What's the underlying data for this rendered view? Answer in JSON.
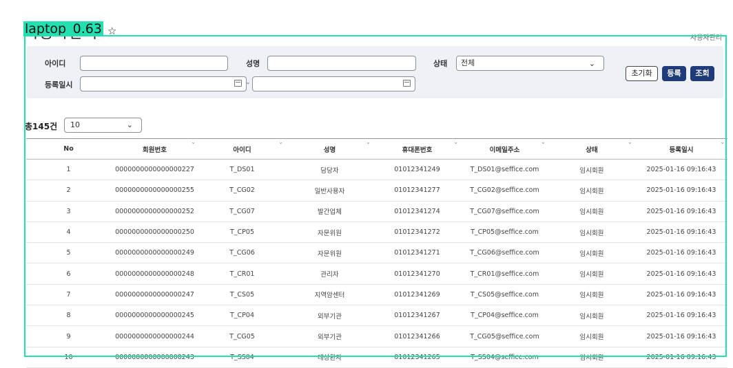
{
  "overlay": {
    "label": "laptop_0.63"
  },
  "header": {
    "title": "사용자관리",
    "breadcrumb": "사용자관리"
  },
  "search": {
    "id_label": "아이디",
    "name_label": "성명",
    "status_label": "상태",
    "status_value": "전체",
    "date_label": "등록일시",
    "date_separator": "-",
    "reset_label": "초기화",
    "register_label": "등록",
    "search_label": "조회"
  },
  "list": {
    "total_text": "총145건",
    "page_size": "10"
  },
  "table": {
    "headers": [
      "No",
      "회원번호",
      "아이디",
      "성명",
      "휴대폰번호",
      "이메일주소",
      "상태",
      "등록일시"
    ],
    "rows": [
      [
        "1",
        "0000000000000000227",
        "T_DS01",
        "담당자",
        "01012341249",
        "T_DS01@seffice.com",
        "임시회원",
        "2025-01-16 09:16:43"
      ],
      [
        "2",
        "0000000000000000255",
        "T_CG02",
        "일반사용자",
        "01012341277",
        "T_CG02@seffice.com",
        "임시회원",
        "2025-01-16 09:16:43"
      ],
      [
        "3",
        "0000000000000000252",
        "T_CG07",
        "발간업체",
        "01012341274",
        "T_CG07@seffice.com",
        "임시회원",
        "2025-01-16 09:16:43"
      ],
      [
        "4",
        "0000000000000000250",
        "T_CP05",
        "자문위원",
        "01012341272",
        "T_CP05@seffice.com",
        "임시회원",
        "2025-01-16 09:16:43"
      ],
      [
        "5",
        "0000000000000000249",
        "T_CG06",
        "자문위원",
        "01012341271",
        "T_CG06@seffice.com",
        "임시회원",
        "2025-01-16 09:16:43"
      ],
      [
        "6",
        "0000000000000000248",
        "T_CR01",
        "관리자",
        "01012341270",
        "T_CR01@seffice.com",
        "임시회원",
        "2025-01-16 09:16:43"
      ],
      [
        "7",
        "0000000000000000247",
        "T_CS05",
        "지역암센터",
        "01012341269",
        "T_CS05@seffice.com",
        "임시회원",
        "2025-01-16 09:16:43"
      ],
      [
        "8",
        "0000000000000000245",
        "T_CP04",
        "외부기관",
        "01012341267",
        "T_CP04@seffice.com",
        "임시회원",
        "2025-01-16 09:16:43"
      ],
      [
        "9",
        "0000000000000000244",
        "T_CG05",
        "외부기관",
        "01012341266",
        "T_CG05@seffice.com",
        "임시회원",
        "2025-01-16 09:16:43"
      ],
      [
        "10",
        "0000000000000000243",
        "T_SS04",
        "대상환자",
        "01012341265",
        "T_SS04@seffice.com",
        "임시회원",
        "2025-01-16 09:16:43"
      ]
    ]
  },
  "icons": [
    "star-icon",
    "calendar-icon",
    "chevron-down-icon",
    "sort-icon"
  ],
  "colors": {
    "accent": "#1f3b7a",
    "panel": "#eef1f6",
    "overlay": "#22e0b0"
  }
}
